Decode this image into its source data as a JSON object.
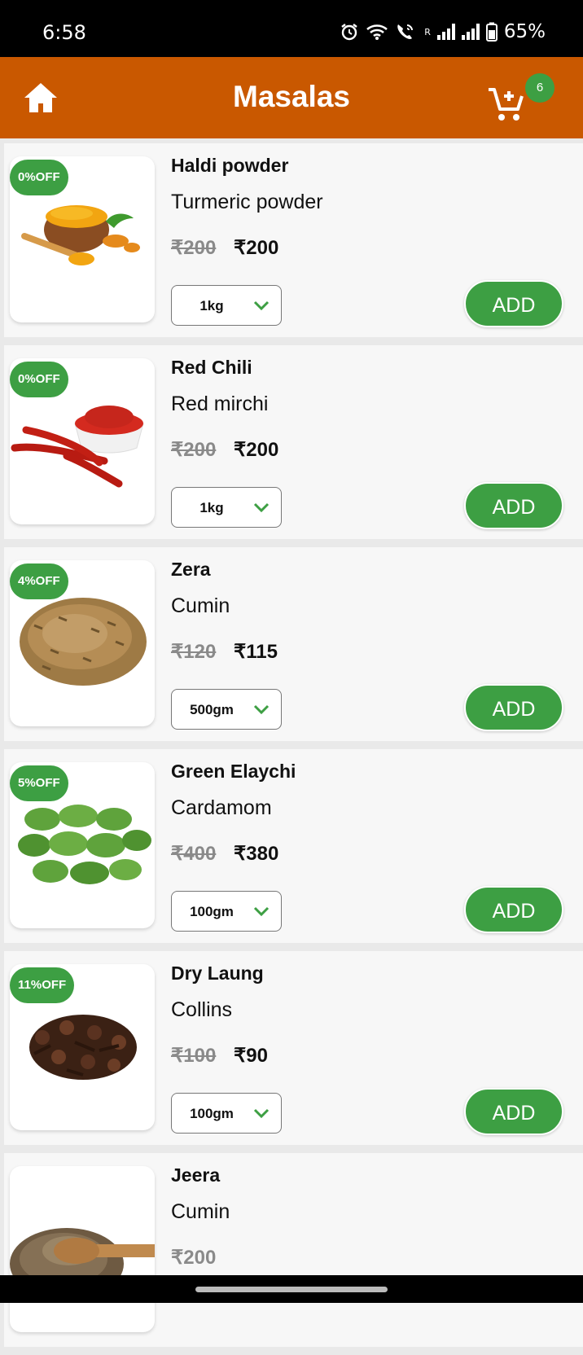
{
  "status": {
    "time": "6:58",
    "battery": "65%",
    "net_label": "R"
  },
  "header": {
    "title": "Masalas",
    "cart_count": "6"
  },
  "colors": {
    "header": "#c95800",
    "accent_green": "#3d9f43"
  },
  "icons": {
    "home": "home-icon",
    "cart": "add-shopping-cart-icon",
    "dropdown": "chevron-down-icon"
  },
  "products": [
    {
      "name": "Haldi powder",
      "desc": "Turmeric powder",
      "mrp": "₹200",
      "price": "₹200",
      "off": "0%OFF",
      "qty": "1kg",
      "add": "ADD"
    },
    {
      "name": "Red Chili",
      "desc": "Red mirchi",
      "mrp": "₹200",
      "price": "₹200",
      "off": "0%OFF",
      "qty": "1kg",
      "add": "ADD"
    },
    {
      "name": "Zera",
      "desc": "Cumin",
      "mrp": "₹120",
      "price": "₹115",
      "off": "4%OFF",
      "qty": "500gm",
      "add": "ADD"
    },
    {
      "name": "Green Elaychi",
      "desc": "Cardamom",
      "mrp": "₹400",
      "price": "₹380",
      "off": "5%OFF",
      "qty": "100gm",
      "add": "ADD"
    },
    {
      "name": "Dry Laung",
      "desc": "Collins",
      "mrp": "₹100",
      "price": "₹90",
      "off": "11%OFF",
      "qty": "100gm",
      "add": "ADD"
    },
    {
      "name": "Jeera",
      "desc": "Cumin",
      "mrp": "₹200"
    }
  ]
}
